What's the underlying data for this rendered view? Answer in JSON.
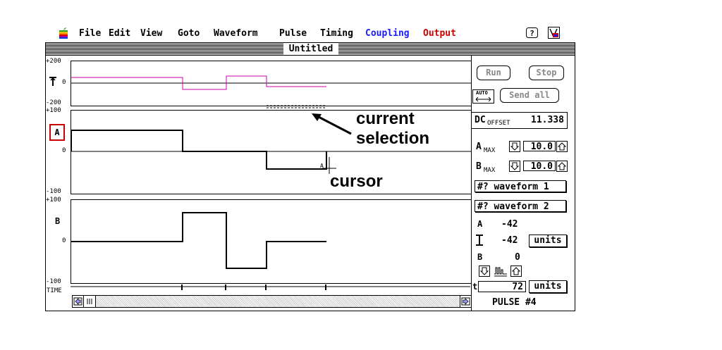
{
  "menubar": {
    "apple_icon": "apple-logo-icon",
    "items": [
      {
        "label": "File",
        "color": "#000000"
      },
      {
        "label": "Edit",
        "color": "#000000"
      },
      {
        "label": "View",
        "color": "#000000"
      },
      {
        "label": "Goto",
        "color": "#000000"
      },
      {
        "label": "Waveform",
        "color": "#000000"
      },
      {
        "label": "Pulse",
        "color": "#000000"
      },
      {
        "label": "Timing",
        "color": "#000000"
      },
      {
        "label": "Coupling",
        "color": "#1a1aff"
      },
      {
        "label": "Output",
        "color": "#cc0000"
      }
    ],
    "help_icon": "help-question-icon",
    "app_icon": "application-icon"
  },
  "window": {
    "title": "Untitled"
  },
  "overview": {
    "ticks": [
      "+200",
      "0",
      "-200"
    ],
    "trace_color": "#cc00aa"
  },
  "channel_a": {
    "label": "A",
    "label_border_color": "#cc0000",
    "ticks": [
      "+100",
      "0",
      "-100"
    ],
    "cursor_tag": "A"
  },
  "channel_b": {
    "label": "B",
    "ticks": [
      "+100",
      "0",
      "-100"
    ]
  },
  "time_label": "TIME",
  "controls": {
    "run": "Run",
    "stop": "Stop",
    "auto": "AUTO",
    "send_all": "Send all",
    "dc_label": "DC",
    "dc_sub": "OFFSET",
    "dc_value": "11.338",
    "a_max_label": "A",
    "a_max_sub": "MAX",
    "a_max_value": "10.0",
    "b_max_label": "B",
    "b_max_sub": "MAX",
    "b_max_value": "10.0",
    "waveform1": "#? waveform 1",
    "waveform2": "#? waveform 2",
    "a_label": "A",
    "a_value": "-42",
    "ref_value": "-42",
    "units_label": "units",
    "b_label": "B",
    "b_value": "0",
    "t_label": "t",
    "t_value": "72",
    "pulse_label": "PULSE #4"
  },
  "annotations": {
    "selection_line1": "current",
    "selection_line2": "selection",
    "cursor": "cursor"
  }
}
